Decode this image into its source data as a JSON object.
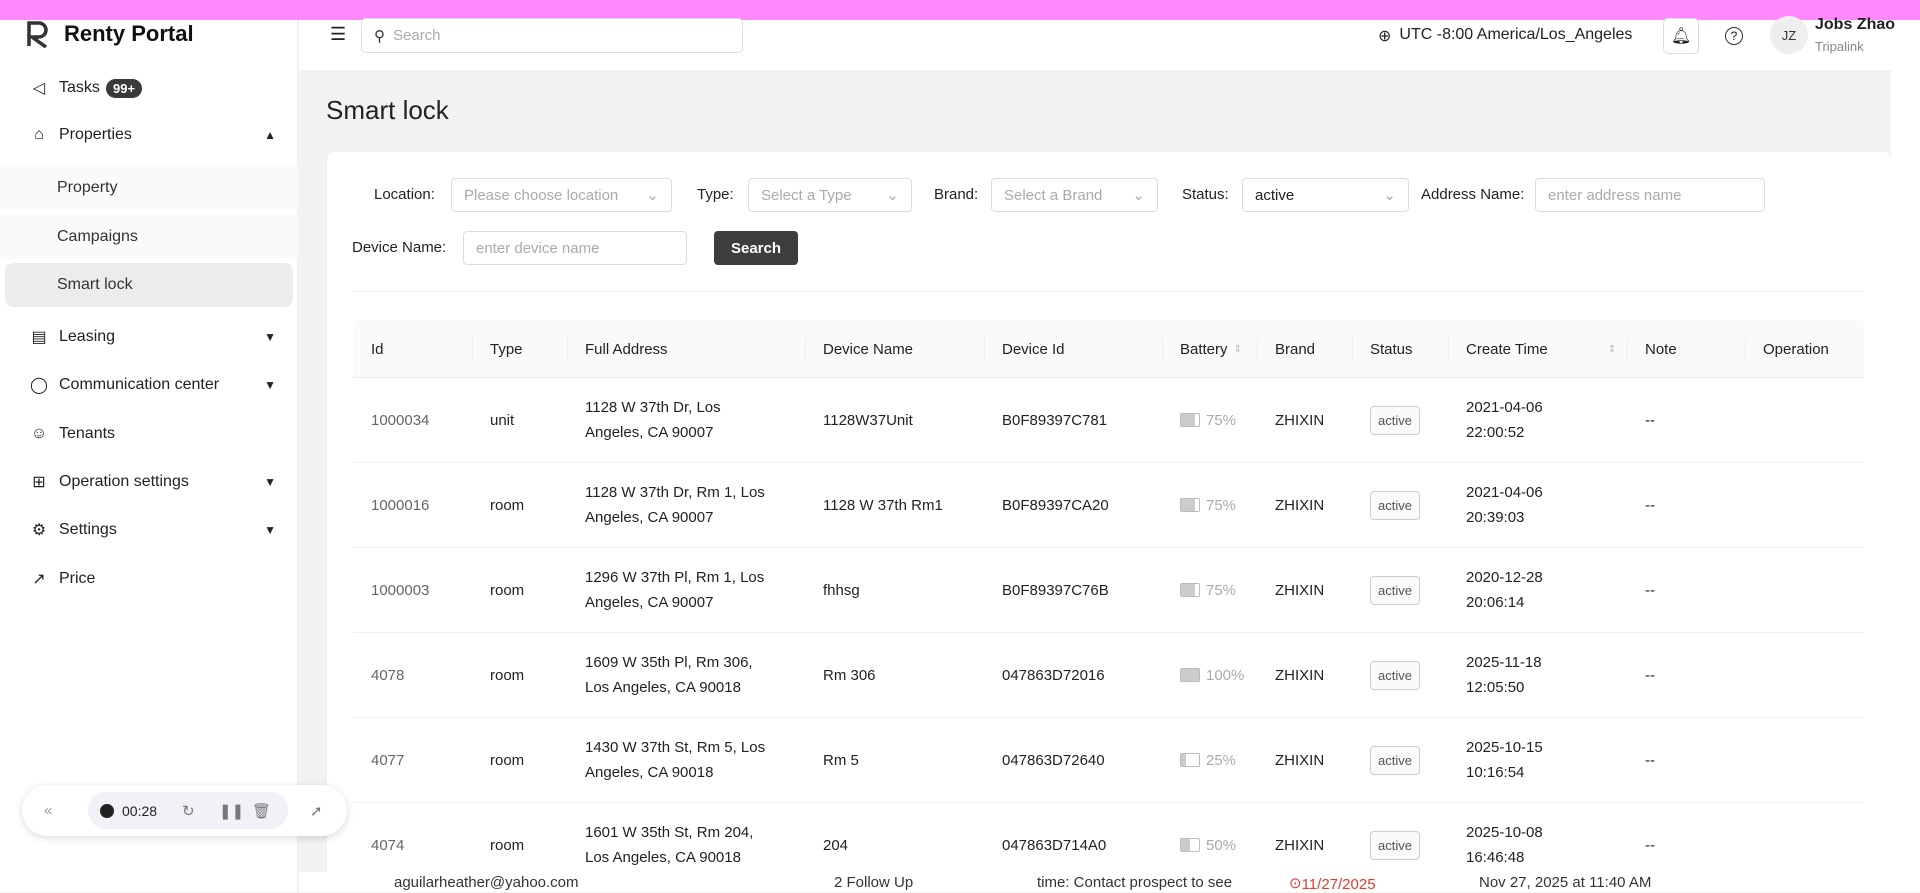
{
  "app": {
    "name": "Renty Portal"
  },
  "sidebar": {
    "tasks": {
      "label": "Tasks",
      "badge": "99+"
    },
    "properties": {
      "label": "Properties",
      "children": [
        "Property",
        "Campaigns",
        "Smart lock"
      ]
    },
    "items": [
      "Leasing",
      "Communication center",
      "Tenants",
      "Operation settings",
      "Settings",
      "Price"
    ]
  },
  "topbar": {
    "search_placeholder": "Search",
    "timezone": "UTC -8:00 America/Los_Angeles",
    "user_initials": "JZ",
    "user_name": "Jobs Zhao",
    "user_org": "Tripalink"
  },
  "page": {
    "title": "Smart lock"
  },
  "filters": {
    "location": {
      "label": "Location",
      "placeholder": "Please choose location"
    },
    "type": {
      "label": "Type",
      "placeholder": "Select a Type"
    },
    "brand": {
      "label": "Brand",
      "placeholder": "Select a Brand"
    },
    "status": {
      "label": "Status",
      "value": "active"
    },
    "address": {
      "label": "Address Name",
      "placeholder": "enter address name"
    },
    "device": {
      "label": "Device Name",
      "placeholder": "enter device name"
    },
    "search_label": "Search"
  },
  "table": {
    "columns": [
      "Id",
      "Type",
      "Full Address",
      "Device Name",
      "Device Id",
      "Battery",
      "Brand",
      "Status",
      "Create Time",
      "Note",
      "Operation"
    ],
    "rows": [
      {
        "id": "1000034",
        "type": "unit",
        "addr1": "1128 W 37th Dr, Los",
        "addr2": "Angeles, CA 90007",
        "device": "1128W37Unit",
        "device_id": "B0F89397C781",
        "battery": "75%",
        "battery_level": 75,
        "brand": "ZHIXIN",
        "status": "active",
        "date": "2021-04-06",
        "time": "22:00:52",
        "note": "--"
      },
      {
        "id": "1000016",
        "type": "room",
        "addr1": "1128 W 37th Dr, Rm 1, Los",
        "addr2": "Angeles, CA 90007",
        "device": "1128 W 37th Rm1",
        "device_id": "B0F89397CA20",
        "battery": "75%",
        "battery_level": 75,
        "brand": "ZHIXIN",
        "status": "active",
        "date": "2021-04-06",
        "time": "20:39:03",
        "note": "--"
      },
      {
        "id": "1000003",
        "type": "room",
        "addr1": "1296 W 37th Pl, Rm 1, Los",
        "addr2": "Angeles, CA 90007",
        "device": "fhhsg",
        "device_id": "B0F89397C76B",
        "battery": "75%",
        "battery_level": 75,
        "brand": "ZHIXIN",
        "status": "active",
        "date": "2020-12-28",
        "time": "20:06:14",
        "note": "--"
      },
      {
        "id": "4078",
        "type": "room",
        "addr1": "1609 W 35th Pl, Rm 306,",
        "addr2": "Los Angeles, CA 90018",
        "device": "Rm 306",
        "device_id": "047863D72016",
        "battery": "100%",
        "battery_level": 100,
        "brand": "ZHIXIN",
        "status": "active",
        "date": "2025-11-18",
        "time": "12:05:50",
        "note": "--"
      },
      {
        "id": "4077",
        "type": "room",
        "addr1": "1430 W 37th St, Rm 5, Los",
        "addr2": "Angeles, CA 90018",
        "device": "Rm 5",
        "device_id": "047863D72640",
        "battery": "25%",
        "battery_level": 25,
        "brand": "ZHIXIN",
        "status": "active",
        "date": "2025-10-15",
        "time": "10:16:54",
        "note": "--"
      },
      {
        "id": "4074",
        "type": "room",
        "addr1": "1601 W 35th St, Rm 204,",
        "addr2": "Los Angeles, CA 90018",
        "device": "204",
        "device_id": "047863D714A0",
        "battery": "50%",
        "battery_level": 50,
        "brand": "ZHIXIN",
        "status": "active",
        "date": "2025-10-08",
        "time": "16:46:48",
        "note": "--"
      }
    ]
  },
  "bleed": {
    "email": "aguilarheather@yahoo.com",
    "followup": "2 Follow Up",
    "task": "time: Contact prospect to see",
    "due": "11/27/2025",
    "created": "Nov 27, 2025 at 11:40 AM"
  },
  "recorder": {
    "time": "00:28"
  },
  "colors": {
    "accent": "#3d3d3d",
    "overdue": "#e53935"
  }
}
